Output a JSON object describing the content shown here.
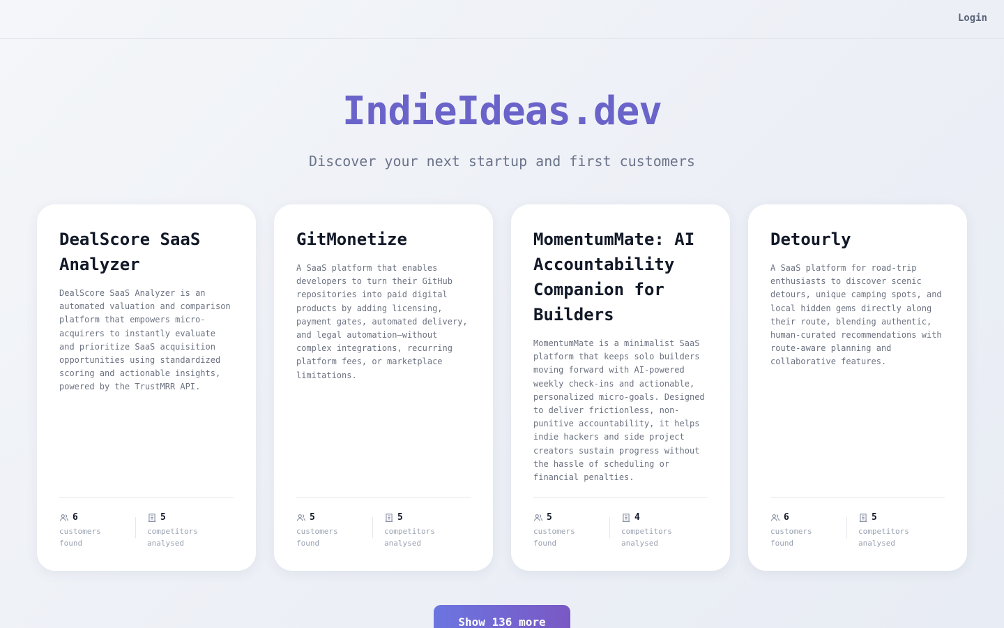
{
  "header": {
    "login_label": "Login"
  },
  "hero": {
    "title": "IndieIdeas.dev",
    "subtitle": "Discover your next startup and first customers"
  },
  "cards": [
    {
      "title": "DealScore SaaS Analyzer",
      "description": "DealScore SaaS Analyzer is an automated valuation and comparison platform that empowers micro-acquirers to instantly evaluate and prioritize SaaS acquisition opportunities using standardized scoring and actionable insights, powered by the TrustMRR API.",
      "customers": "6",
      "customers_label": "customers found",
      "competitors": "5",
      "competitors_label": "competitors analysed"
    },
    {
      "title": "GitMonetize",
      "description": "A SaaS platform that enables developers to turn their GitHub repositories into paid digital products by adding licensing, payment gates, automated delivery, and legal automation—without complex integrations, recurring platform fees, or marketplace limitations.",
      "customers": "5",
      "customers_label": "customers found",
      "competitors": "5",
      "competitors_label": "competitors analysed"
    },
    {
      "title": "MomentumMate: AI Accountability Companion for Builders",
      "description": "MomentumMate is a minimalist SaaS platform that keeps solo builders moving forward with AI-powered weekly check-ins and actionable, personalized micro-goals. Designed to deliver frictionless, non-punitive accountability, it helps indie hackers and side project creators sustain progress without the hassle of scheduling or financial penalties.",
      "customers": "5",
      "customers_label": "customers found",
      "competitors": "4",
      "competitors_label": "competitors analysed"
    },
    {
      "title": "Detourly",
      "description": "A SaaS platform for road-trip enthusiasts to discover scenic detours, unique camping spots, and local hidden gems directly along their route, blending authentic, human-curated recommendations with route-aware planning and collaborative features.",
      "customers": "6",
      "customers_label": "customers found",
      "competitors": "5",
      "competitors_label": "competitors analysed"
    }
  ],
  "show_more_label": "Show 136 more",
  "icons": {
    "customers": "users-icon",
    "competitors": "building-icon"
  }
}
